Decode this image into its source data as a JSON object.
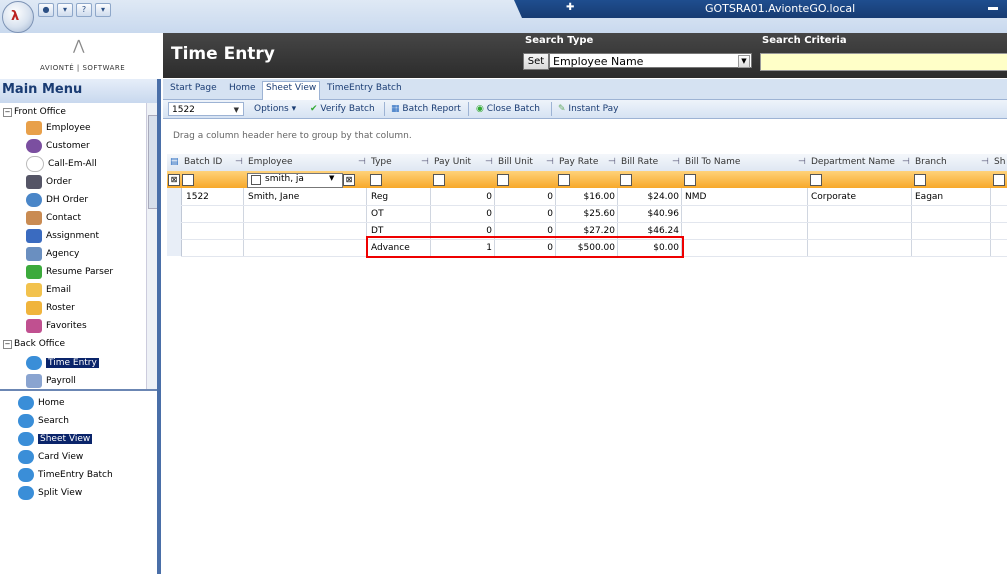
{
  "window": {
    "hostname": "GOTSRA01.AvionteGO.local"
  },
  "logo": {
    "text": "AVIONTÉ | SOFTWARE"
  },
  "header": {
    "page_title": "Time Entry",
    "search_type_label": "Search Type",
    "search_criteria_label": "Search Criteria",
    "set_label": "Set",
    "search_type_value": "Employee Name",
    "search_criteria_value": ""
  },
  "main_menu": {
    "title": "Main Menu",
    "front_office": "Front Office",
    "front_items": [
      "Employee",
      "Customer",
      "Call-Em-All",
      "Order",
      "DH Order",
      "Contact",
      "Assignment",
      "Agency",
      "Resume Parser",
      "Email",
      "Roster",
      "Favorites"
    ],
    "back_office": "Back Office",
    "back_items": [
      "Time Entry",
      "Payroll"
    ],
    "sub_items": [
      "Home",
      "Search",
      "Sheet View",
      "Card View",
      "TimeEntry Batch",
      "Split View"
    ]
  },
  "tabs": [
    "Start Page",
    "Home",
    "Sheet View",
    "TimeEntry Batch"
  ],
  "toolbar": {
    "batch_value": "1522",
    "options": "Options",
    "verify": "Verify Batch",
    "report": "Batch Report",
    "close": "Close Batch",
    "instant": "Instant Pay"
  },
  "grid": {
    "group_hint": "Drag a column header here to group by that column.",
    "columns": [
      "Batch ID",
      "Employee",
      "Type",
      "Pay Unit",
      "Bill Unit",
      "Pay Rate",
      "Bill Rate",
      "Bill To Name",
      "Department Name",
      "Branch",
      "Sh"
    ],
    "employee_filter": "smith, ja",
    "rows": [
      {
        "batch_id": "1522",
        "employee": "Smith, Jane",
        "type": "Reg",
        "pay_unit": "0",
        "bill_unit": "0",
        "pay_rate": "$16.00",
        "bill_rate": "$24.00",
        "bill_to": "NMD",
        "department": "Corporate",
        "branch": "Eagan"
      },
      {
        "batch_id": "",
        "employee": "",
        "type": "OT",
        "pay_unit": "0",
        "bill_unit": "0",
        "pay_rate": "$25.60",
        "bill_rate": "$40.96",
        "bill_to": "",
        "department": "",
        "branch": ""
      },
      {
        "batch_id": "",
        "employee": "",
        "type": "DT",
        "pay_unit": "0",
        "bill_unit": "0",
        "pay_rate": "$27.20",
        "bill_rate": "$46.24",
        "bill_to": "",
        "department": "",
        "branch": ""
      },
      {
        "batch_id": "",
        "employee": "",
        "type": "Advance",
        "pay_unit": "1",
        "bill_unit": "0",
        "pay_rate": "$500.00",
        "bill_rate": "$0.00",
        "bill_to": "",
        "department": "",
        "branch": ""
      }
    ]
  },
  "colors": {
    "accent": "#0a246a",
    "filter_row": "#f7a82a",
    "highlight": "#e00000",
    "header_bg": "#2c2c2c"
  }
}
